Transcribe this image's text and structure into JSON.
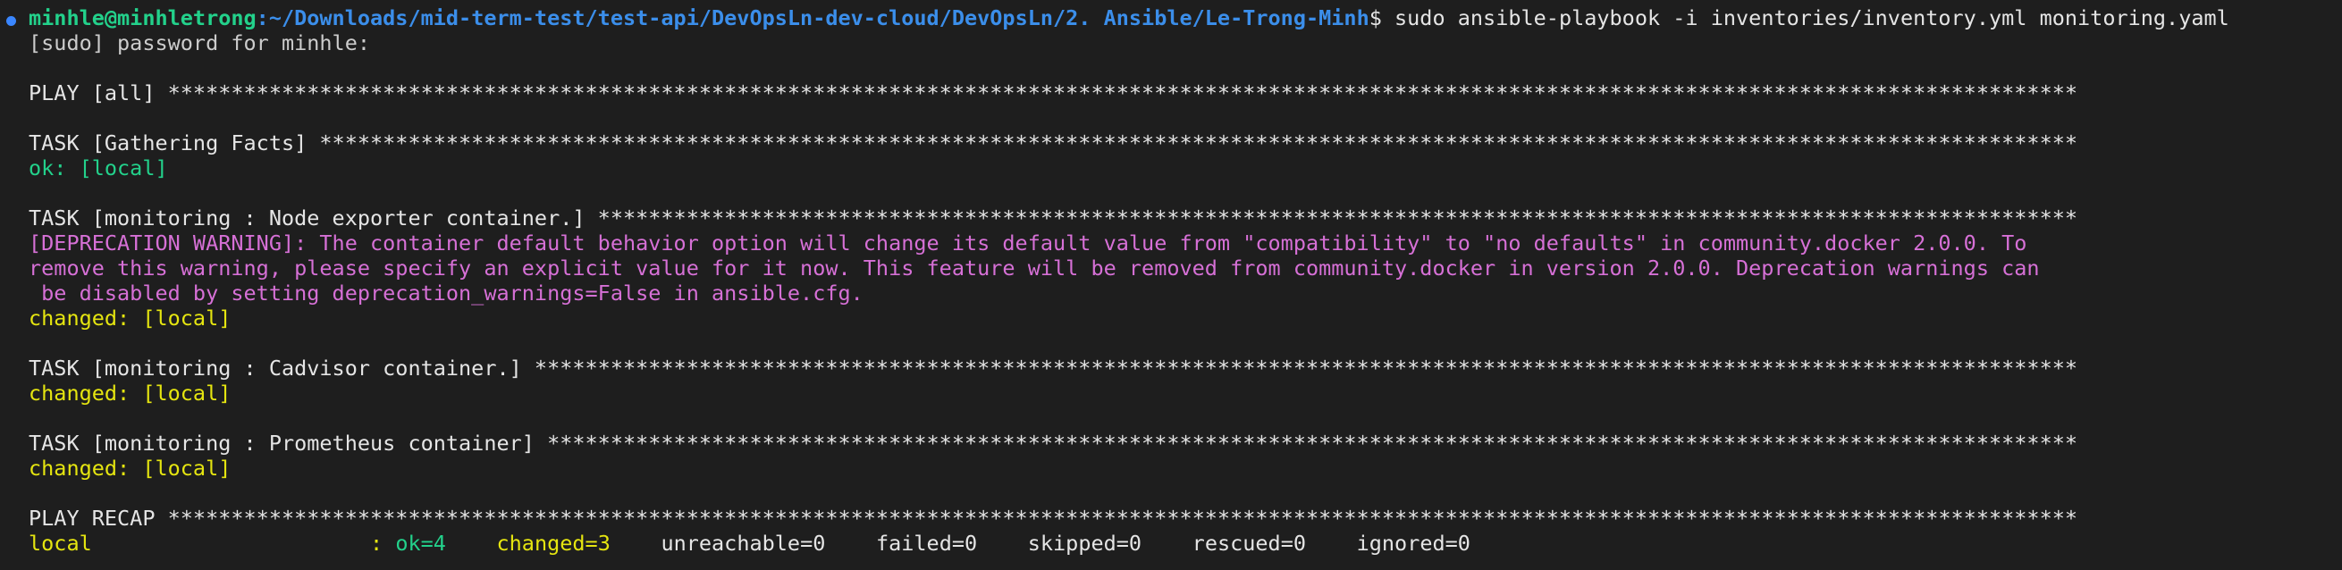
{
  "colors": {
    "background": "#1e1e1e",
    "default_text": "#cccccc",
    "user_host": "#23d18b",
    "path": "#3b8eea",
    "ok": "#23d18b",
    "changed": "#e5e510",
    "warning": "#d670d6",
    "prompt_dot": "#3a86ff"
  },
  "prompt": {
    "user_host": "minhle@minhletrong",
    "path": ":~/Downloads/mid-term-test/test-api/DevOpsLn-dev-cloud/DevOpsLn/2. Ansible/Le-Trong-Minh",
    "symbol": "$ ",
    "command": "sudo ansible-playbook -i inventories/inventory.yml monitoring.yaml"
  },
  "sudo_prompt": "[sudo] password for minhle:",
  "play_all": "PLAY [all] *******************************************************************************************************************************************************",
  "task_facts": {
    "header": "TASK [Gathering Facts] *******************************************************************************************************************************************",
    "result": "ok: [local]"
  },
  "task_node": {
    "header": "TASK [monitoring : Node exporter container.] *********************************************************************************************************************",
    "warning_1": "[DEPRECATION WARNING]: The container default behavior option will change its default value from \"compatibility\" to \"no defaults\" in community.docker 2.0.0. To",
    "warning_2": "remove this warning, please specify an explicit value for it now. This feature will be removed from community.docker in version 2.0.0. Deprecation warnings can",
    "warning_3": " be disabled by setting deprecation_warnings=False in ansible.cfg.",
    "result": "changed: [local]"
  },
  "task_cadvisor": {
    "header": "TASK [monitoring : Cadvisor container.] **************************************************************************************************************************",
    "result": "changed: [local]"
  },
  "task_prometheus": {
    "header": "TASK [monitoring : Prometheus container] *************************************************************************************************************************",
    "result": "changed: [local]"
  },
  "recap": {
    "header": "PLAY RECAP *******************************************************************************************************************************************************",
    "host": "local                      : ",
    "ok": "ok=4   ",
    "changed": " changed=3   ",
    "rest": " unreachable=0    failed=0    skipped=0    rescued=0    ignored=0"
  }
}
